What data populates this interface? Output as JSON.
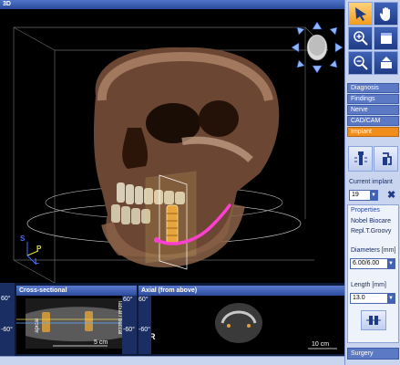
{
  "window": {
    "title": "3D"
  },
  "viewport": {
    "axis_labels": {
      "s": "S",
      "p": "P",
      "l": "L"
    }
  },
  "bottom": {
    "cross_sectional": {
      "title": "Cross-sectional",
      "angle_top": "60°",
      "angle_bottom": "-60°",
      "side_left": "apical",
      "side_right": "labial / buccal",
      "scale": "5 cm"
    },
    "axial": {
      "title": "Axial (from above)",
      "angle_top": "60°",
      "angle_bottom": "-60°",
      "orientation": "R",
      "scale": "10 cm"
    },
    "left_edge": {
      "angle_top": "60°",
      "angle_bottom": "-60°"
    }
  },
  "right_panel": {
    "tabs": [
      {
        "label": "Diagnosis",
        "active": false
      },
      {
        "label": "Findings",
        "active": false
      },
      {
        "label": "Nerve",
        "active": false
      },
      {
        "label": "CAD/CAM",
        "active": false
      },
      {
        "label": "Implant",
        "active": true
      }
    ],
    "current_implant_label": "Current implant",
    "current_implant_value": "19",
    "properties_label": "Properties",
    "manufacturer": "Nobel Biocare",
    "model": "Repl.T.Groovy",
    "diameters_label": "Diameters [mm]",
    "diameters_value": "6.00/6.00",
    "length_label": "Length [mm]",
    "length_value": "13.0",
    "surgery_label": "Surgery"
  },
  "colors": {
    "accent": "#f08d1c",
    "tab_blue": "#5b79c4",
    "panel_bg": "#c9d5ef",
    "nerve": "#ff3fd0"
  }
}
